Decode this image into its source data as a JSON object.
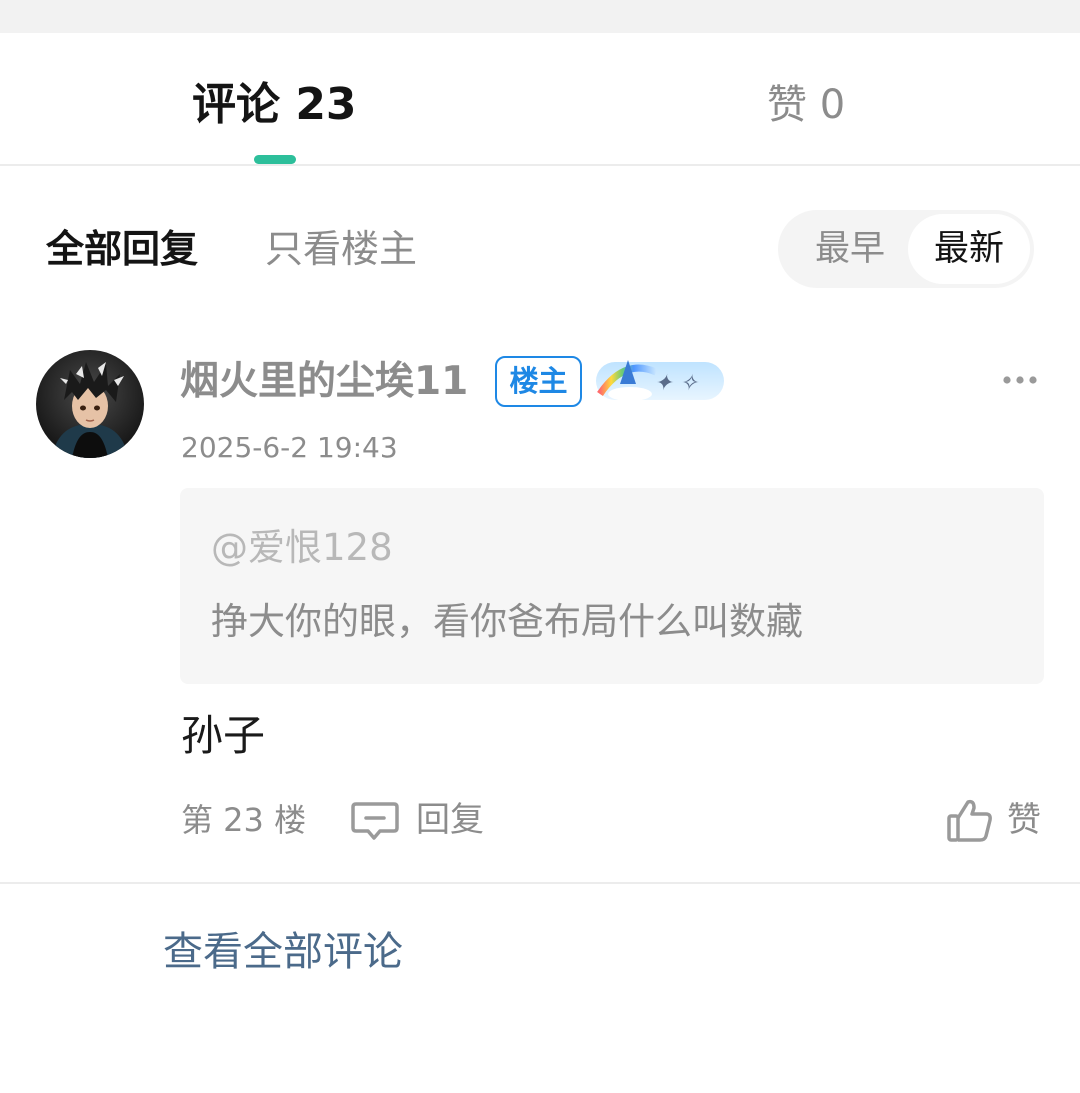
{
  "tabs": {
    "comments_label": "评论 23",
    "likes_label": "赞 0"
  },
  "filters": {
    "all_replies": "全部回复",
    "owner_only": "只看楼主",
    "sort_earliest": "最早",
    "sort_latest": "最新",
    "active_sort": "最新"
  },
  "comment": {
    "username": "烟火里的尘埃11",
    "owner_badge": "楼主",
    "medal_icon": "rainbow-medal-icon",
    "timestamp": "2025-6-2 19:43",
    "quote": {
      "user": "@爱恨128",
      "text": "挣大你的眼，看你爸布局什么叫数藏"
    },
    "body": "孙子",
    "floor": "第 23 楼",
    "reply_label": "回复",
    "like_label": "赞"
  },
  "footer": {
    "view_all": "查看全部评论"
  },
  "colors": {
    "accent": "#2dbf9b",
    "badge_blue": "#1e88e5",
    "link": "#4b6a8a",
    "muted": "#8c8c8c"
  }
}
